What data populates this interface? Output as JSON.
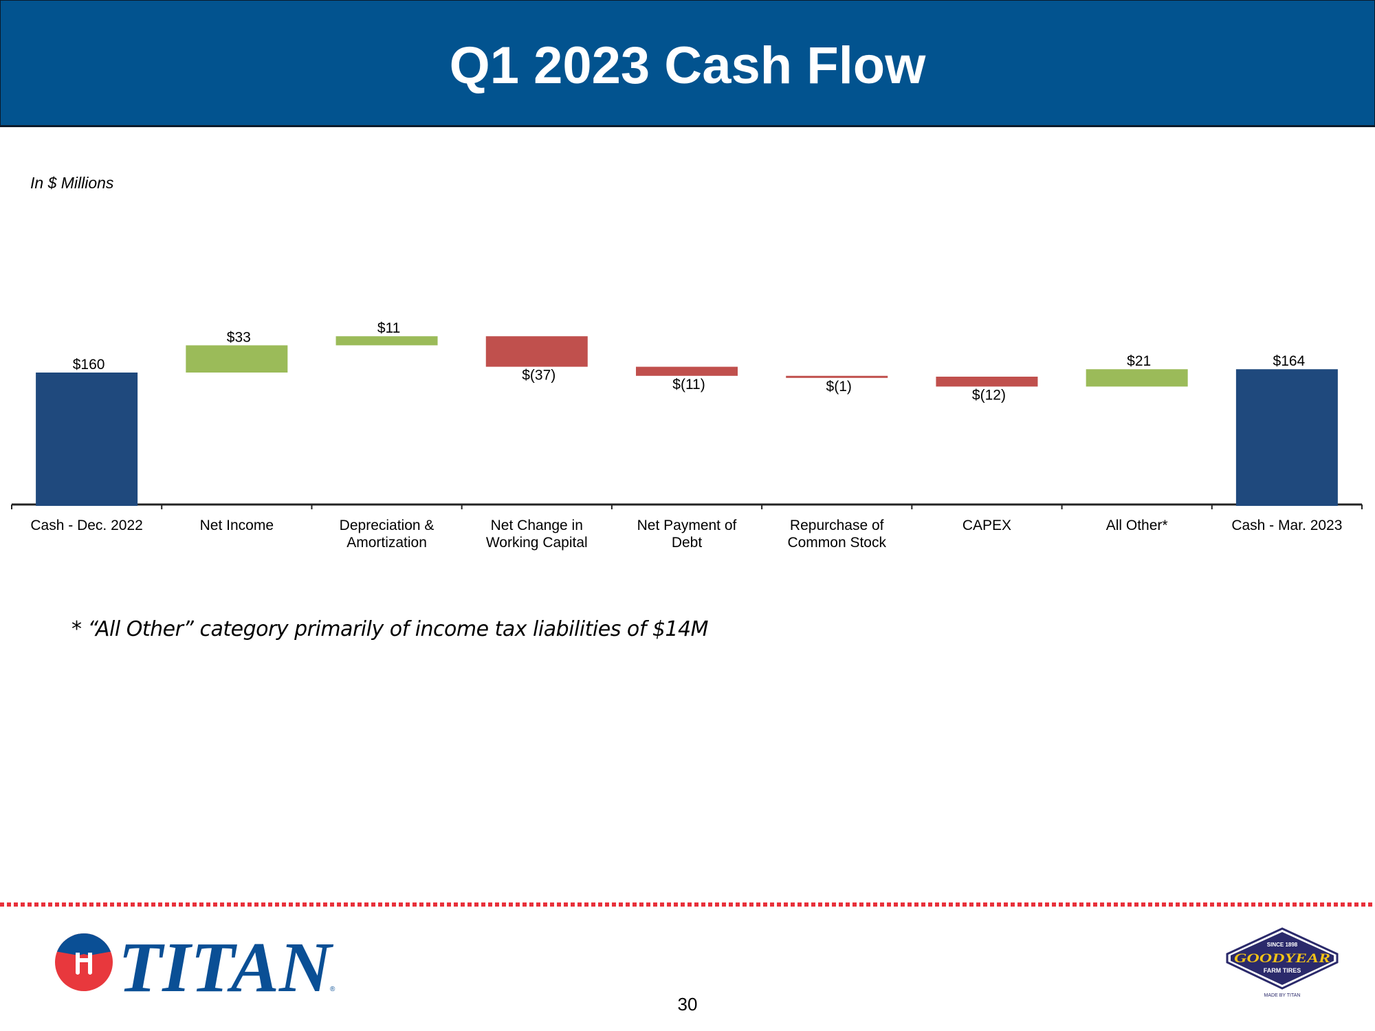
{
  "header": {
    "title": "Q1 2023 Cash Flow"
  },
  "units_label": "In $ Millions",
  "footnote": "* “All Other” category primarily of income tax liabilities of $14M",
  "page_number": "30",
  "logos": {
    "titan": {
      "text": "TITAN",
      "registered": "®"
    },
    "goodyear": {
      "since": "SINCE 1898",
      "brand": "GOODYEAR",
      "subtitle": "FARM TIRES",
      "made_by": "MADE BY TITAN"
    }
  },
  "colors": {
    "header_bg": "#02538f",
    "total_bar": "#1f497d",
    "increase_bar": "#9bbb59",
    "decrease_bar": "#c0504d",
    "dotted_rule": "#e8303a",
    "titan_blue": "#0a4f95",
    "titan_red": "#e8383d",
    "goodyear_navy": "#2b2a6b",
    "goodyear_gold": "#f3c316"
  },
  "chart_data": {
    "type": "bar",
    "subtype": "waterfall",
    "title": "Q1 2023 Cash Flow",
    "ylabel": "In $ Millions",
    "xlabel": "",
    "categories": [
      [
        "Cash - Dec. 2022"
      ],
      [
        "Net Income"
      ],
      [
        "Depreciation &",
        "Amortization"
      ],
      [
        "Net Change in",
        "Working Capital"
      ],
      [
        "Net Payment of",
        "Debt"
      ],
      [
        "Repurchase of",
        "Common Stock"
      ],
      [
        "CAPEX"
      ],
      [
        "All Other*"
      ],
      [
        "Cash - Mar. 2023"
      ]
    ],
    "values": [
      160,
      33,
      11,
      -37,
      -11,
      -1,
      -12,
      21,
      164
    ],
    "kinds": [
      "total",
      "increase",
      "increase",
      "decrease",
      "decrease",
      "decrease",
      "decrease",
      "increase",
      "total"
    ],
    "data_labels": [
      "$160",
      "$33",
      "$11",
      "$(37)",
      "$(11)",
      "$(1)",
      "$(12)",
      "$21",
      "$164"
    ],
    "ylim": [
      0,
      215
    ],
    "grid": false,
    "legend": "none"
  }
}
